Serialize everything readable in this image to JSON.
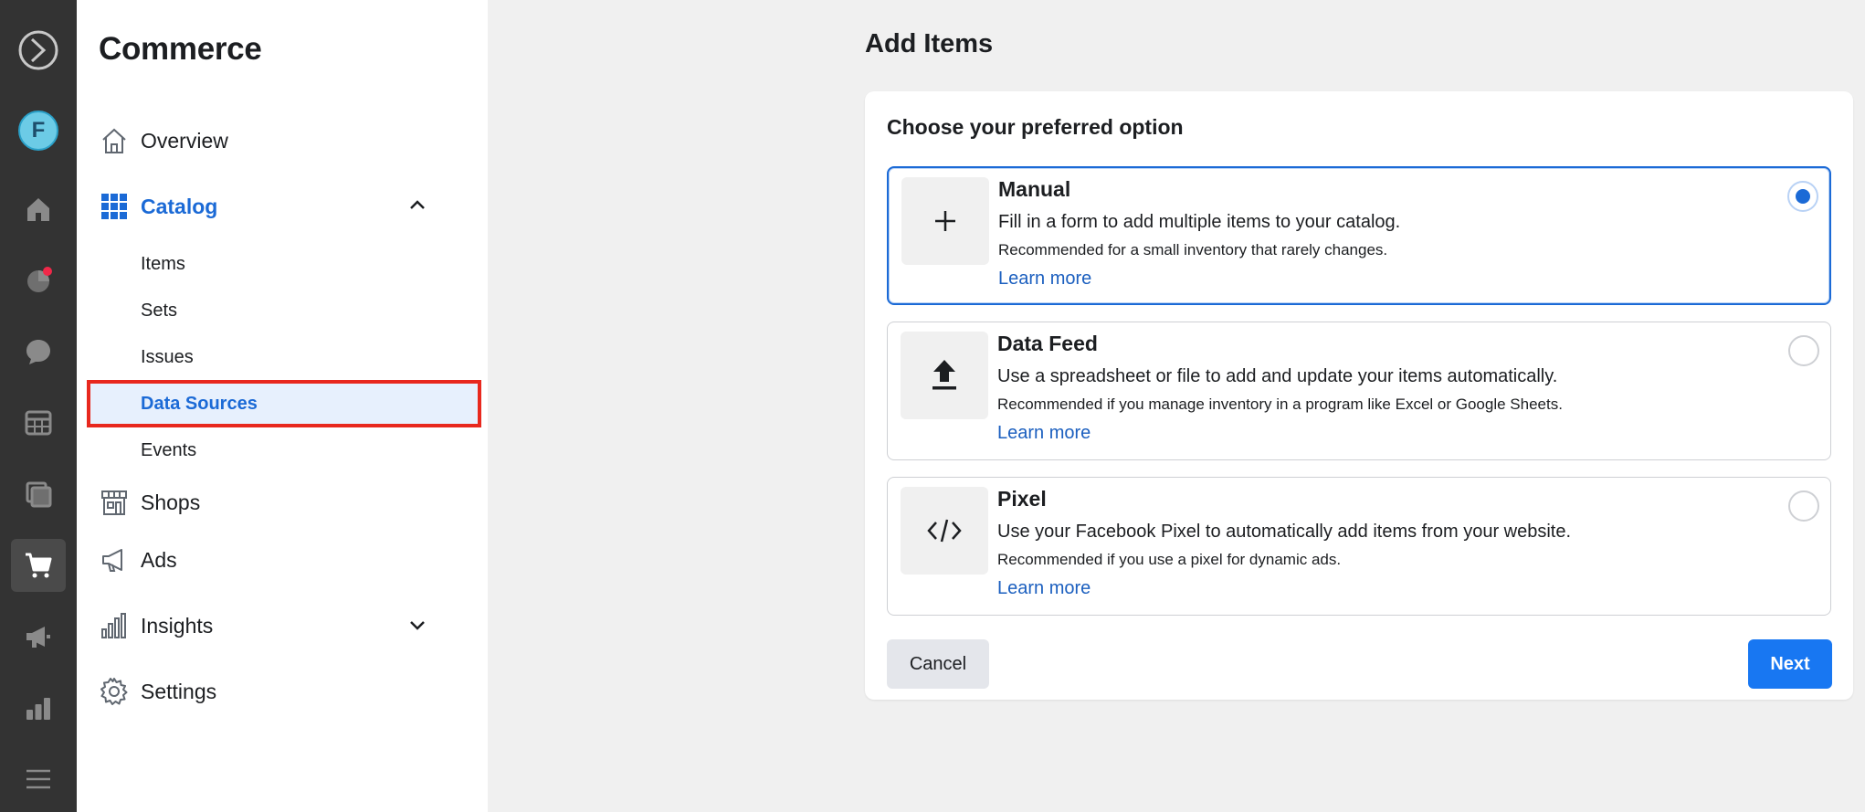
{
  "rail": {
    "avatar_letter": "F",
    "icons": [
      "meta-logo-icon",
      "home-icon",
      "activity-icon",
      "chat-icon",
      "table-icon",
      "pages-icon",
      "cart-icon",
      "megaphone-icon",
      "bar-chart-icon",
      "menu-icon"
    ],
    "active": "cart-icon"
  },
  "sidebar": {
    "title": "Commerce",
    "items": [
      {
        "label": "Overview",
        "icon": "home-outline-icon"
      },
      {
        "label": "Catalog",
        "icon": "grid-icon",
        "expanded": true
      },
      {
        "label": "Shops",
        "icon": "storefront-icon"
      },
      {
        "label": "Ads",
        "icon": "megaphone-outline-icon"
      },
      {
        "label": "Insights",
        "icon": "bar-chart-outline-icon"
      },
      {
        "label": "Settings",
        "icon": "gear-icon"
      }
    ],
    "catalog_sub": [
      "Items",
      "Sets",
      "Issues",
      "Data Sources",
      "Events"
    ],
    "selected_sub": "Data Sources"
  },
  "main": {
    "title": "Add Items",
    "heading": "Choose your preferred option",
    "options": [
      {
        "title": "Manual",
        "desc": "Fill in a form to add multiple items to your catalog.",
        "sub": "Recommended for a small inventory that rarely changes.",
        "link": "Learn more",
        "selected": true,
        "icon": "plus-icon"
      },
      {
        "title": "Data Feed",
        "desc": "Use a spreadsheet or file to add and update your items automatically.",
        "sub": "Recommended if you manage inventory in a program like Excel or Google Sheets.",
        "link": "Learn more",
        "selected": false,
        "icon": "upload-icon"
      },
      {
        "title": "Pixel",
        "desc": "Use your Facebook Pixel to automatically add items from your website.",
        "sub": "Recommended if you use a pixel for dynamic ads.",
        "link": "Learn more",
        "selected": false,
        "icon": "code-icon"
      }
    ],
    "cancel_label": "Cancel",
    "next_label": "Next"
  },
  "colors": {
    "accent": "#1877f2",
    "link": "#1b5fbf",
    "highlight_outline": "#e8281e"
  }
}
